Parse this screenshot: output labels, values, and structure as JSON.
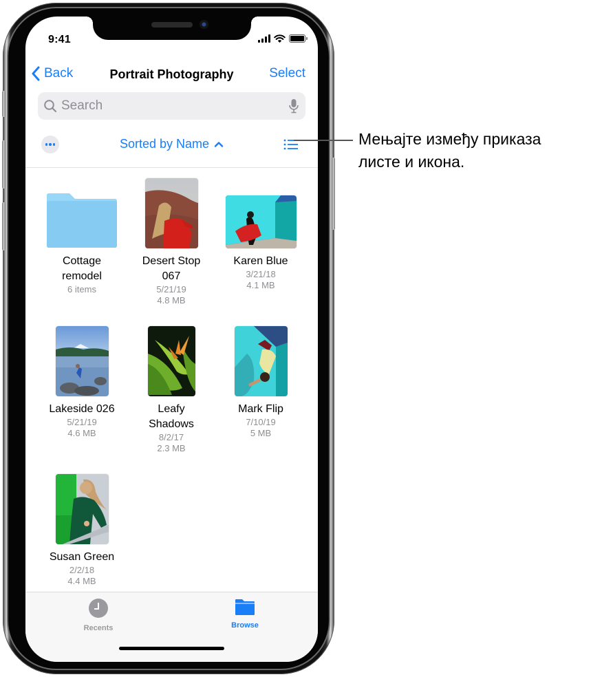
{
  "status_bar": {
    "time": "9:41",
    "icons": [
      "cellular-signal-icon",
      "wifi-icon",
      "battery-icon"
    ],
    "battery_level": 1.0
  },
  "nav": {
    "back_label": "Back",
    "title": "Portrait Photography",
    "select_label": "Select"
  },
  "search": {
    "placeholder": "Search",
    "value": ""
  },
  "toolbar": {
    "sort_label": "Sorted by Name",
    "sort_direction": "ascending"
  },
  "items": [
    {
      "name_line1": "Cottage",
      "name_line2": "remodel",
      "meta1": "6 items",
      "meta2": "",
      "kind": "folder"
    },
    {
      "name_line1": "Desert Stop",
      "name_line2": "067",
      "meta1": "5/21/19",
      "meta2": "4.8 MB",
      "kind": "photo"
    },
    {
      "name_line1": "Karen Blue",
      "name_line2": "",
      "meta1": "3/21/18",
      "meta2": "4.1 MB",
      "kind": "photo"
    },
    {
      "name_line1": "Lakeside 026",
      "name_line2": "",
      "meta1": "5/21/19",
      "meta2": "4.6 MB",
      "kind": "photo"
    },
    {
      "name_line1": "Leafy",
      "name_line2": "Shadows",
      "meta1": "8/2/17",
      "meta2": "2.3 MB",
      "kind": "photo"
    },
    {
      "name_line1": "Mark Flip",
      "name_line2": "",
      "meta1": "7/10/19",
      "meta2": "5 MB",
      "kind": "photo"
    },
    {
      "name_line1": "Susan Green",
      "name_line2": "",
      "meta1": "2/2/18",
      "meta2": "4.4 MB",
      "kind": "photo"
    }
  ],
  "tabbar": {
    "tabs": [
      {
        "label": "Recents",
        "icon": "clock-icon",
        "active": false
      },
      {
        "label": "Browse",
        "icon": "folder-icon",
        "active": true
      }
    ]
  },
  "callout": {
    "line1": "Мењајте између приказа",
    "line2": "листе и икона."
  },
  "colors": {
    "accent": "#1a7ef7",
    "secondary_text": "#8e8e93",
    "folder": "#8fd0f5"
  }
}
